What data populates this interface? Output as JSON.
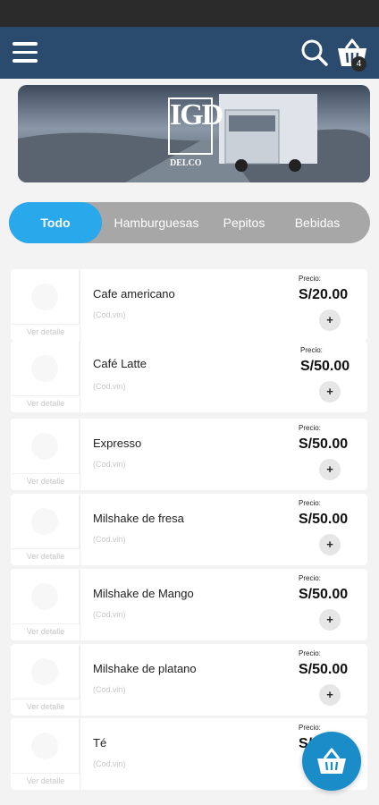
{
  "header": {
    "menu_icon": "hamburger-menu-icon",
    "search_icon": "search-icon",
    "cart_icon": "shopping-basket-icon",
    "cart_count": "4"
  },
  "banner": {
    "logo_letters": "IGD",
    "logo_text": "DELCO"
  },
  "categories": [
    {
      "label": "Todo",
      "active": true
    },
    {
      "label": "Hamburguesas",
      "active": false
    },
    {
      "label": "Pepitos",
      "active": false
    },
    {
      "label": "Bebidas",
      "active": false
    }
  ],
  "products": [
    {
      "name": "Cafe americano",
      "code": "(Cod.vin)",
      "price_label": "Precio:",
      "price": "S/20.00",
      "add": "+",
      "detail": "Ver detalle"
    },
    {
      "name": "Café Latte",
      "code": "(Cod.vin)",
      "price_label": "Precio:",
      "price": "S/50.00",
      "add": "+",
      "detail": "Ver detalle"
    },
    {
      "name": "Expresso",
      "code": "(Cod.vin)",
      "price_label": "Precio:",
      "price": "S/50.00",
      "add": "+",
      "detail": "Ver detalle"
    },
    {
      "name": "Milshake de fresa",
      "code": "(Cod.vin)",
      "price_label": "Precio:",
      "price": "S/50.00",
      "add": "+",
      "detail": "Ver detalle"
    },
    {
      "name": "Milshake de Mango",
      "code": "(Cod.vin)",
      "price_label": "Precio:",
      "price": "S/50.00",
      "add": "+",
      "detail": "Ver detalle"
    },
    {
      "name": "Milshake de platano",
      "code": "(Cod.vin)",
      "price_label": "Precio:",
      "price": "S/50.00",
      "add": "+",
      "detail": "Ver detalle"
    },
    {
      "name": "Té",
      "code": "(Cod.vin)",
      "price_label": "Precio:",
      "price": "S/",
      "add": "+",
      "detail": "Ver detalle"
    }
  ],
  "fab": {
    "icon": "shopping-basket-icon"
  },
  "colors": {
    "appbar": "#2a4a6e",
    "accent": "#29a8ec",
    "fab": "#1a8cc8",
    "tabs_bg": "#a7a7a7"
  }
}
